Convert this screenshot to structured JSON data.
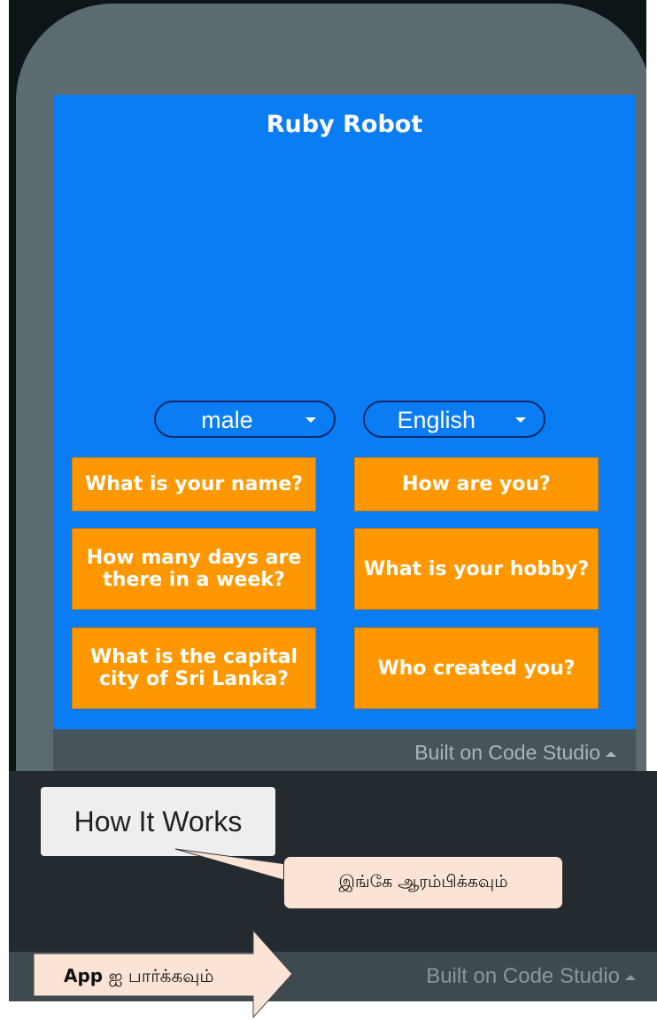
{
  "app": {
    "title": "Ruby Robot",
    "gender_select": {
      "value": "male"
    },
    "language_select": {
      "value": "English"
    },
    "questions": [
      "What is your name?",
      "How are you?",
      "How many days are there in a week?",
      "What is your hobby?",
      "What is the capital city of Sri Lanka?",
      "Who created you?"
    ],
    "colors": {
      "background": "#0a7cf4",
      "button": "#ff9800"
    }
  },
  "footer_top": {
    "built_label": "Built on Code Studio"
  },
  "panel": {
    "how_it_works_label": "How It Works",
    "callout_text": "இங்கே ஆரம்பிக்கவும்"
  },
  "footer_bottom": {
    "built_label": "Built on Code Studio",
    "arrow_label_bold": "App",
    "arrow_label_rest": " ஐ பார்க்கவும்"
  }
}
